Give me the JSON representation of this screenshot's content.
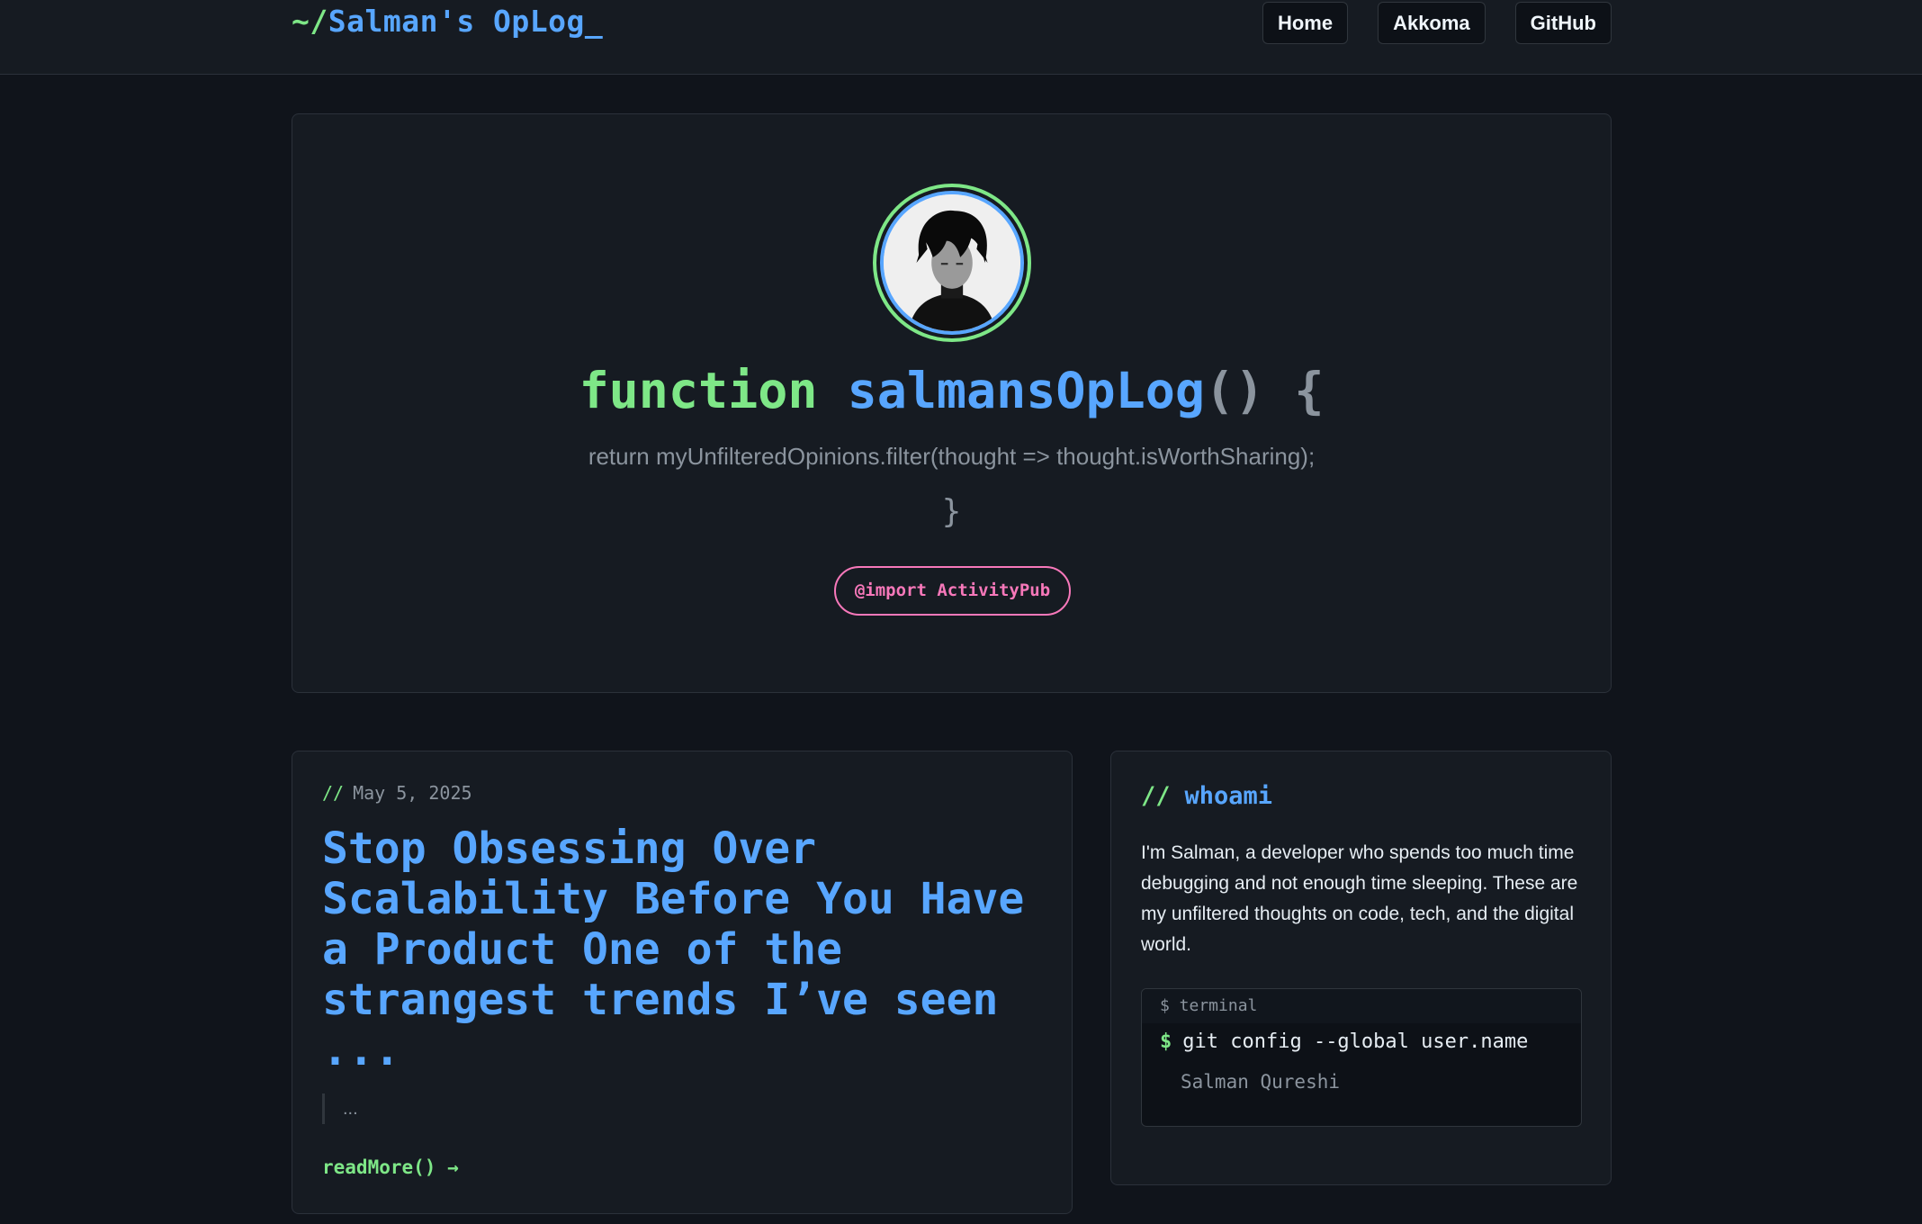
{
  "header": {
    "logo_prefix": "~/",
    "logo_text": "Salman's OpLog_",
    "nav": [
      "Home",
      "Akkoma",
      "GitHub"
    ]
  },
  "hero": {
    "keyword": "function",
    "function_name": "salmansOpLog",
    "parens": "()",
    "open_brace": "{",
    "return_line": "return myUnfilteredOpinions.filter(thought => thought.isWorthSharing);",
    "close_brace": "}",
    "import_label": "@import ActivityPub"
  },
  "post": {
    "comment": "//",
    "date": "May 5, 2025",
    "title": "Stop Obsessing Over Scalability Before You Have a Product One of the strangest trends I’ve seen ...",
    "excerpt": "...",
    "read_more": "readMore() →"
  },
  "sidebar": {
    "comment": "//",
    "title": "whoami",
    "bio": "I'm Salman, a developer who spends too much time debugging and not enough time sleeping. These are my unfiltered thoughts on code, tech, and the digital world.",
    "terminal": {
      "header": "$ terminal",
      "prompt": "$",
      "command": "git config --global user.name",
      "output": "Salman Qureshi"
    }
  },
  "colors": {
    "accent_blue": "#58a6ff",
    "accent_green": "#7ee787",
    "accent_pink": "#f778ba",
    "background": "#10141b",
    "card": "#161b22"
  }
}
